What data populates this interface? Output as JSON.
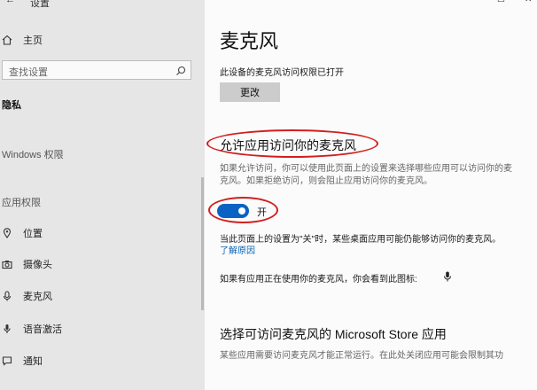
{
  "window": {
    "title": "设置",
    "controls": {
      "minimize": "—",
      "maximize": "☐",
      "close": "✕"
    }
  },
  "sidebar": {
    "home_label": "主页",
    "search_placeholder": "查找设置",
    "section_title": "隐私",
    "windows_permissions": "Windows 权限",
    "app_permissions": "应用权限",
    "items": [
      {
        "label": "位置",
        "icon": "location-icon"
      },
      {
        "label": "摄像头",
        "icon": "camera-icon"
      },
      {
        "label": "麦克风",
        "icon": "microphone-icon"
      },
      {
        "label": "语音激活",
        "icon": "voice-activation-icon"
      },
      {
        "label": "通知",
        "icon": "notification-icon"
      }
    ]
  },
  "main": {
    "page_title": "麦克风",
    "device_status": "此设备的麦克风访问权限已打开",
    "change_button": "更改",
    "allow_apps_heading": "允许应用访问你的麦克风",
    "allow_apps_desc_line1": "如果允许访问，你可以使用此页面上的设置来选择哪些应用可以访问你的麦",
    "allow_apps_desc_line2": "克风。如果拒绝访问，则会阻止应用访问你的麦克风。",
    "toggle_state_label": "开",
    "toggle_on": true,
    "note_off": "当此页面上的设置为\"关\"时，某些桌面应用可能仍能够访问你的麦克风。",
    "learn_why_link": "了解原因",
    "in_use_note": "如果有应用正在使用你的麦克风，你会看到此图标:",
    "store_heading": "选择可访问麦克风的 Microsoft Store 应用",
    "store_desc": "某些应用需要访问麦克风才能正常运行。在此处关闭应用可能会限制其功"
  },
  "colors": {
    "accent": "#0a63c2",
    "annotation": "#d11f1f",
    "sidebar_bg": "#e6e6e6",
    "link": "#0b63b4"
  }
}
